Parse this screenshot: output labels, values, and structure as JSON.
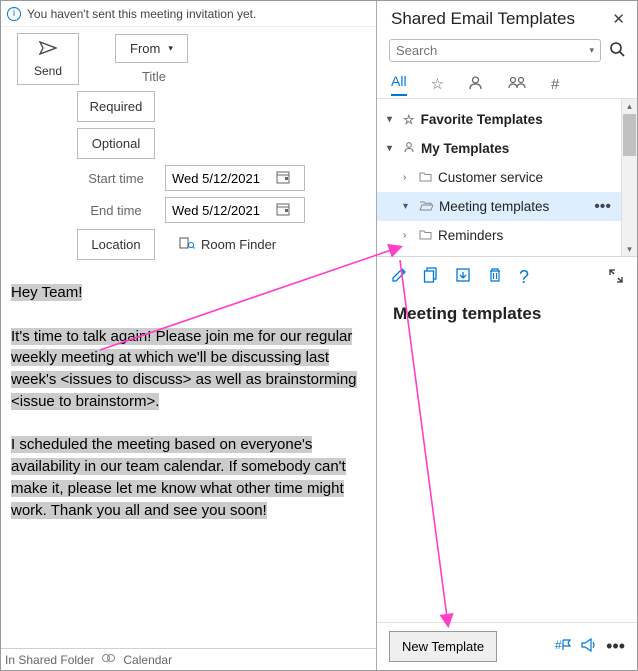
{
  "outlook": {
    "info_bar": "You haven't sent this meeting invitation yet.",
    "send_label": "Send",
    "from_label": "From",
    "title_label": "Title",
    "required_label": "Required",
    "optional_label": "Optional",
    "start_label": "Start time",
    "end_label": "End time",
    "start_value": "Wed 5/12/2021",
    "end_value": "Wed 5/12/2021",
    "location_label": "Location",
    "room_finder": "Room Finder",
    "body": {
      "greeting": "Hey Team!",
      "p1": "It's time to talk again! Please join me for our regular weekly meeting at which we'll be discussing last week's <issues to discuss> as well as brainstorming <issue to brainstorm>.",
      "p2": "I scheduled the meeting based on everyone's availability in our team calendar. If somebody can't make it, please let me know what other time might work. Thank you all and see you soon!"
    },
    "status_folder": "In Shared Folder",
    "status_view": "Calendar"
  },
  "panel": {
    "title": "Shared Email Templates",
    "search_placeholder": "Search",
    "tabs": {
      "all": "All"
    },
    "tree": {
      "favorites": "Favorite Templates",
      "my": "My Templates",
      "items": [
        {
          "label": "Customer service"
        },
        {
          "label": "Meeting templates"
        },
        {
          "label": "Reminders"
        }
      ]
    },
    "heading": "Meeting templates",
    "new_button": "New Template"
  }
}
